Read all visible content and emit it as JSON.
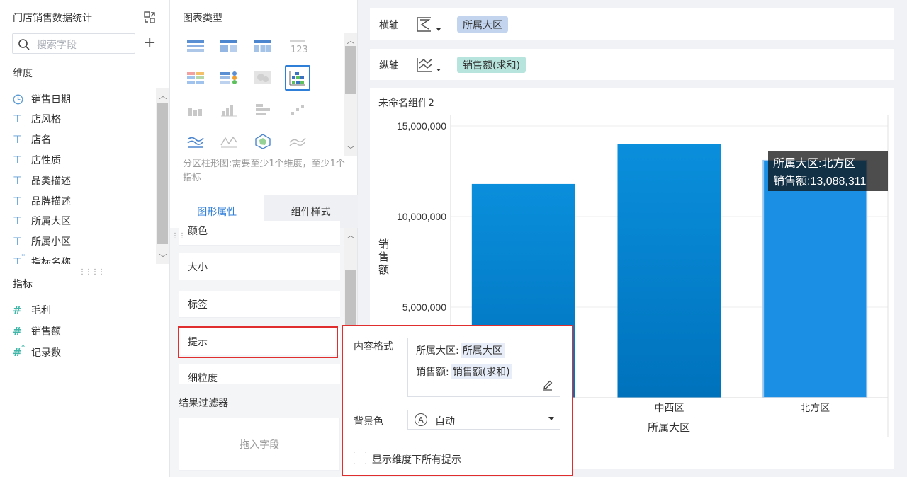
{
  "left": {
    "dataset_title": "门店销售数据统计",
    "search_placeholder": "搜索字段",
    "dimension_label": "维度",
    "dimensions": [
      {
        "icon": "clock-icon",
        "label": "销售日期"
      },
      {
        "icon": "text-field-icon",
        "label": "店风格"
      },
      {
        "icon": "text-field-icon",
        "label": "店名"
      },
      {
        "icon": "text-field-icon",
        "label": "店性质"
      },
      {
        "icon": "text-field-icon",
        "label": "品类描述"
      },
      {
        "icon": "text-field-icon",
        "label": "品牌描述"
      },
      {
        "icon": "text-field-icon",
        "label": "所属大区"
      },
      {
        "icon": "text-field-icon",
        "label": "所属小区"
      },
      {
        "icon": "calc-text-field-icon",
        "label": "指标名称"
      }
    ],
    "measure_label": "指标",
    "measures": [
      {
        "icon": "number-field-icon",
        "label": "毛利"
      },
      {
        "icon": "number-field-icon",
        "label": "销售额"
      },
      {
        "icon": "calc-number-field-icon",
        "label": "记录数"
      }
    ]
  },
  "middle": {
    "chart_type_title": "图表类型",
    "chart_type_icons": [
      "table-icon",
      "crosstable-icon",
      "detail-table-icon",
      "kpi-number-icon",
      "colored-table-icon",
      "dot-table-icon",
      "heatmap-icon",
      "partition-bar-icon",
      "stacked-column-icon",
      "column-icon",
      "partition-stack-icon",
      "scatter-icon",
      "area-icon",
      "line-icon",
      "radar-icon",
      "multi-line-icon"
    ],
    "chart_type_description": "分区柱形图:需要至少1个维度，至少1个指标",
    "tabs": [
      "图形属性",
      "组件样式"
    ],
    "properties": [
      "颜色",
      "大小",
      "标签",
      "提示",
      "细粒度"
    ],
    "filter_title": "结果过滤器",
    "filter_placeholder": "拖入字段"
  },
  "axes": {
    "x_label": "横轴",
    "x_field": "所属大区",
    "y_label": "纵轴",
    "y_field": "销售额(求和)"
  },
  "chart": {
    "component_title": "未命名组件2",
    "tooltip_line1": "所属大区:北方区",
    "tooltip_line2": "销售额:13,088,311",
    "tick_labels": [
      "15,000,000",
      "10,000,000",
      "5,000,000"
    ],
    "x_axis_title": "所属大区",
    "y_axis_title": "销售额",
    "visible_categories": [
      "中西区",
      "北方区"
    ]
  },
  "chart_data": {
    "type": "bar",
    "title": "未命名组件2",
    "xlabel": "所属大区",
    "ylabel": "销售额",
    "categories": [
      "",
      "中西区",
      "北方区"
    ],
    "values": [
      11800000,
      14000000,
      13088311
    ],
    "ylim": [
      0,
      15000000
    ],
    "yticks": [
      5000000,
      10000000,
      15000000
    ],
    "grid": true,
    "bar_color": "#0080cc",
    "highlight_color": "#1a8fe3"
  },
  "popup": {
    "content_format_label": "内容格式",
    "line1_prefix": "所属大区:",
    "line1_tag": "所属大区",
    "line2_prefix": "销售额:",
    "line2_tag": "销售额(求和)",
    "bg_label": "背景色",
    "bg_value": "自动",
    "checkbox_label": "显示维度下所有提示"
  }
}
